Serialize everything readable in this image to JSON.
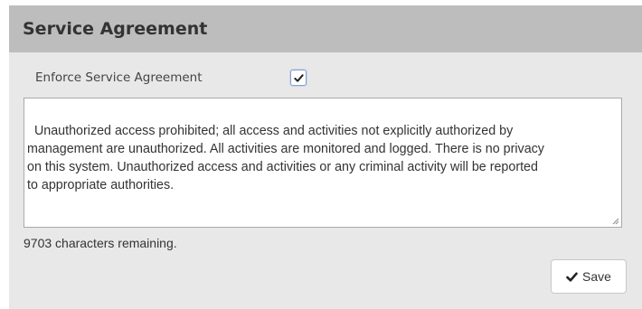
{
  "panel": {
    "title": "Service Agreement"
  },
  "enforce": {
    "label": "Enforce Service Agreement",
    "checked": true,
    "check_icon": "check-icon"
  },
  "agreement": {
    "text": "Unauthorized access prohibited; all access and activities not explicitly authorized by\nmanagement are unauthorized. All activities are monitored and logged. There is no privacy\non this system. Unauthorized access and activities or any criminal activity will be reported\nto appropriate authorities."
  },
  "chars_remaining": "9703 characters remaining.",
  "save": {
    "label": "Save",
    "icon": "check-icon"
  },
  "colors": {
    "header_bg": "#bdbdbd",
    "panel_bg": "#e8e8e8",
    "text": "#333333"
  }
}
